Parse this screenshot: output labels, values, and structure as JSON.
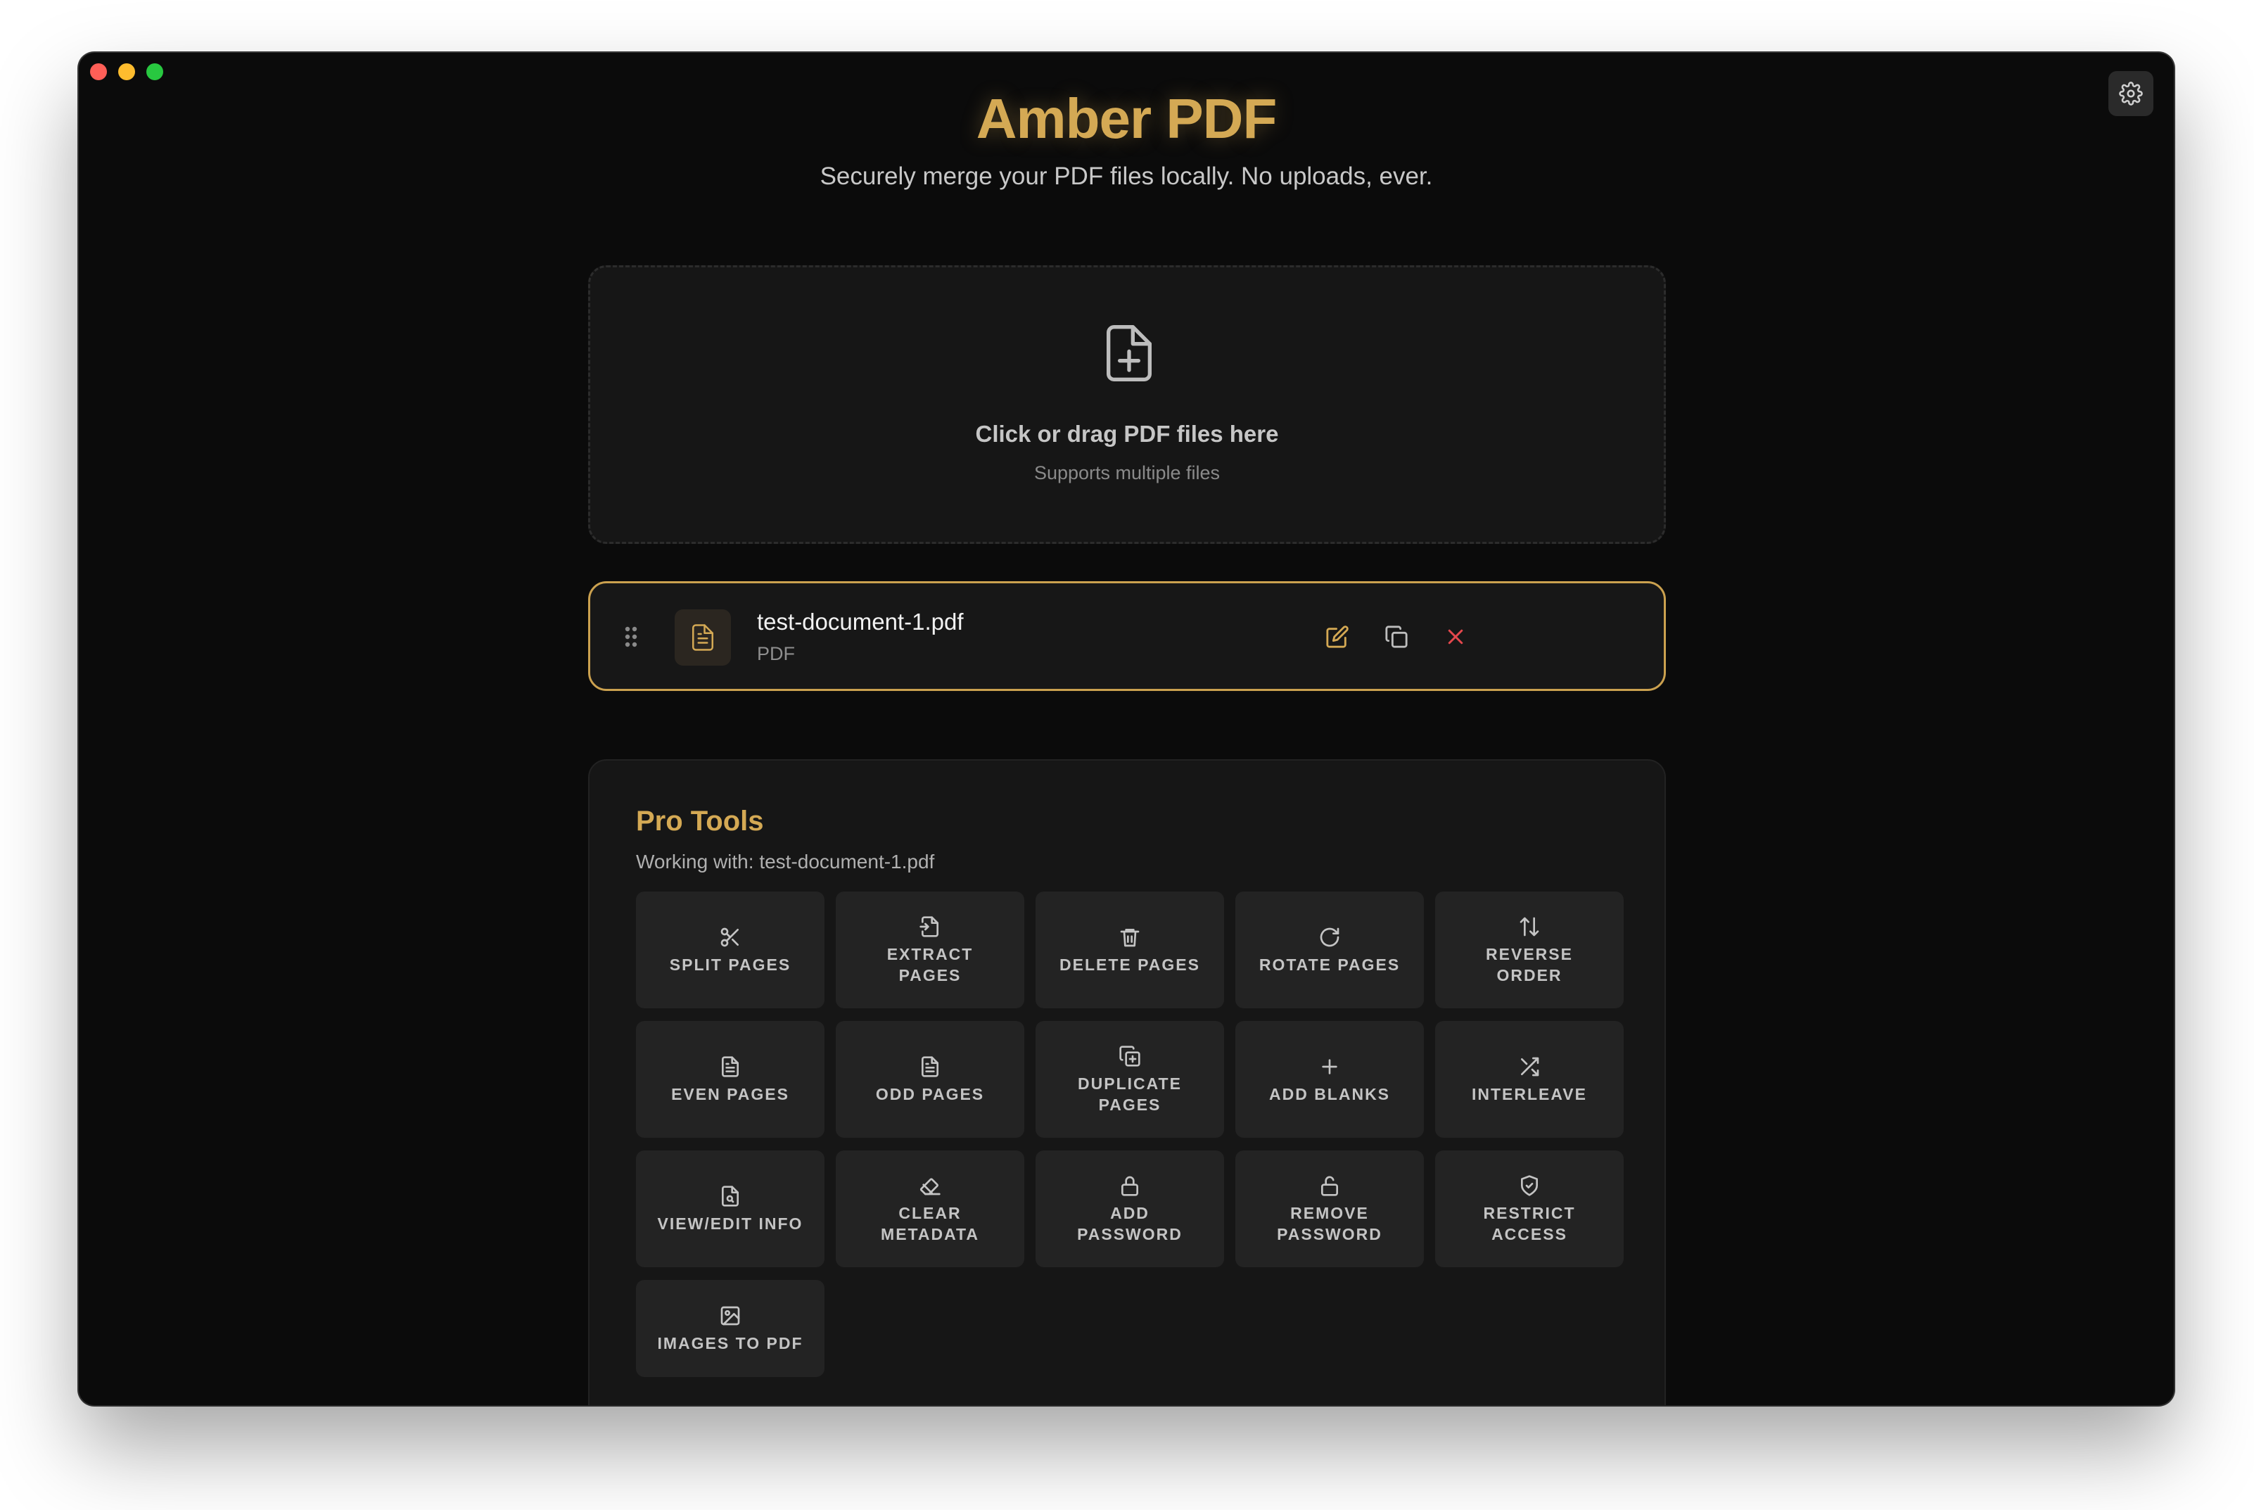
{
  "app": {
    "title": "Amber PDF",
    "subtitle": "Securely merge your PDF files locally. No uploads, ever."
  },
  "window": {
    "traffic_lights": [
      "#ff5f57",
      "#febc2e",
      "#28c840"
    ]
  },
  "settings": {
    "icon": "gear-icon"
  },
  "dropzone": {
    "icon": "file-plus-icon",
    "title": "Click or drag PDF files here",
    "subtitle": "Supports multiple files"
  },
  "files": [
    {
      "name": "test-document-1.pdf",
      "type": "PDF",
      "actions": [
        "edit-icon",
        "duplicate-icon",
        "close-icon"
      ]
    }
  ],
  "pro_tools": {
    "title": "Pro Tools",
    "working_with": "Working with: test-document-1.pdf",
    "tools": [
      {
        "label": "SPLIT PAGES",
        "icon": "scissors-icon"
      },
      {
        "label": "EXTRACT\nPAGES",
        "icon": "file-export-icon"
      },
      {
        "label": "DELETE PAGES",
        "icon": "trash-icon"
      },
      {
        "label": "ROTATE PAGES",
        "icon": "rotate-icon"
      },
      {
        "label": "REVERSE\nORDER",
        "icon": "arrows-up-down-icon"
      },
      {
        "label": "EVEN PAGES",
        "icon": "file-text-icon"
      },
      {
        "label": "ODD PAGES",
        "icon": "file-text-icon"
      },
      {
        "label": "DUPLICATE\nPAGES",
        "icon": "copy-plus-icon"
      },
      {
        "label": "ADD BLANKS",
        "icon": "plus-icon"
      },
      {
        "label": "INTERLEAVE",
        "icon": "shuffle-icon"
      },
      {
        "label": "VIEW/EDIT INFO",
        "icon": "file-search-icon"
      },
      {
        "label": "CLEAR\nMETADATA",
        "icon": "eraser-icon"
      },
      {
        "label": "ADD\nPASSWORD",
        "icon": "lock-icon"
      },
      {
        "label": "REMOVE\nPASSWORD",
        "icon": "unlock-icon"
      },
      {
        "label": "RESTRICT\nACCESS",
        "icon": "shield-check-icon"
      },
      {
        "label": "IMAGES TO PDF",
        "icon": "image-icon"
      }
    ]
  },
  "colors": {
    "accent": "#d4a954",
    "background": "#0b0b0b",
    "panel": "#161616",
    "danger": "#e5484d"
  }
}
